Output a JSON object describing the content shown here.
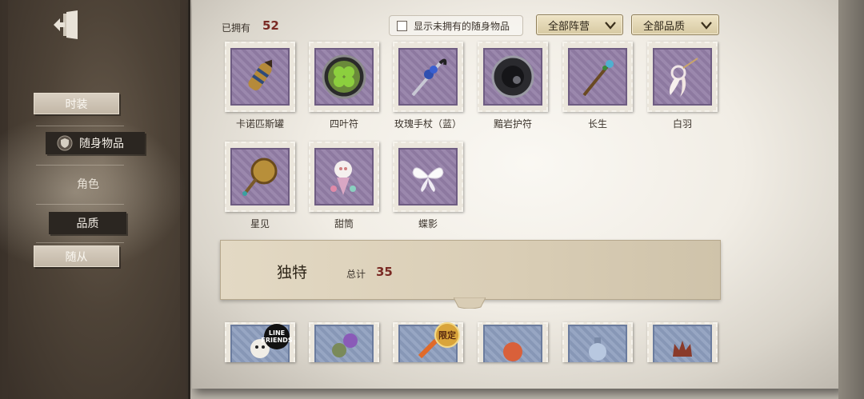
{
  "sidebar": {
    "exit_icon": "exit-door-icon",
    "items": [
      {
        "label": "时装",
        "state": "light"
      },
      {
        "label": "随身物品",
        "state": "selected",
        "icon": "shield-badge-icon"
      },
      {
        "label": "角色",
        "state": "plain"
      },
      {
        "label": "品质",
        "state": "dark"
      },
      {
        "label": "随从",
        "state": "light"
      }
    ]
  },
  "header": {
    "owned_label": "已拥有",
    "owned_count": "52",
    "show_unowned_label": "显示未拥有的随身物品",
    "faction_filter": "全部阵营",
    "quality_filter": "全部品质"
  },
  "items": [
    {
      "name": "卡诺匹斯罐",
      "icon": "canopic-jar-icon"
    },
    {
      "name": "四叶符",
      "icon": "four-leaf-clover-icon"
    },
    {
      "name": "玫瑰手杖（蓝）",
      "icon": "rose-cane-icon"
    },
    {
      "name": "黯岩护符",
      "icon": "dark-rock-amulet-icon"
    },
    {
      "name": "长生",
      "icon": "staff-icon"
    },
    {
      "name": "白羽",
      "icon": "white-feather-icon"
    },
    {
      "name": "星见",
      "icon": "star-mirror-icon"
    },
    {
      "name": "甜筒",
      "icon": "ice-cream-cone-icon"
    },
    {
      "name": "蝶影",
      "icon": "butterfly-icon"
    }
  ],
  "section": {
    "title": "独特",
    "total_label": "总计",
    "total_count": "35"
  },
  "bottom_row": [
    {
      "icon": "line-friends-item-icon",
      "badge": "LINE FRIENDS"
    },
    {
      "icon": "ornament-item-icon"
    },
    {
      "icon": "limited-item-icon",
      "badge": "限定"
    },
    {
      "icon": "orange-item-icon"
    },
    {
      "icon": "bottle-item-icon"
    },
    {
      "icon": "crown-item-icon"
    }
  ],
  "colors": {
    "accent_count": "#7a2a24",
    "stamp_purple": "#8d79a0",
    "stamp_blue": "#8797b6",
    "dropdown_gold": "#d7c9a2"
  }
}
